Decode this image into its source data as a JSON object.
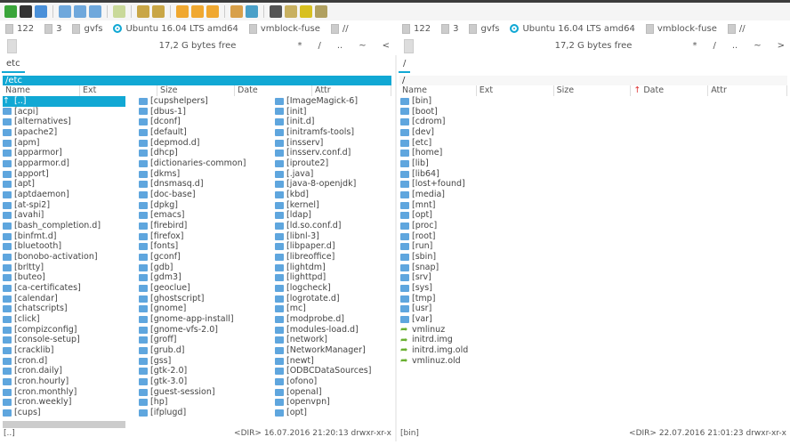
{
  "drives": [
    "122",
    "3",
    "gvfs",
    "Ubuntu 16.04 LTS amd64",
    "vmblock-fuse",
    "//"
  ],
  "left": {
    "free": "17,2 G bytes free",
    "navs": [
      "*",
      "/",
      "..",
      "~",
      "<"
    ],
    "tab": "etc",
    "path": "/etc",
    "columns": [
      "Name",
      "Ext",
      "Size",
      "Date",
      "Attr"
    ],
    "cols": [
      [
        "[..]",
        "[acpi]",
        "[alternatives]",
        "[apache2]",
        "[apm]",
        "[apparmor]",
        "[apparmor.d]",
        "[apport]",
        "[apt]",
        "[aptdaemon]",
        "[at-spi2]",
        "[avahi]",
        "[bash_completion.d]",
        "[binfmt.d]",
        "[bluetooth]",
        "[bonobo-activation]",
        "[brltty]",
        "[buteo]",
        "[ca-certificates]",
        "[calendar]",
        "[chatscripts]",
        "[click]",
        "[compizconfig]",
        "[console-setup]",
        "[cracklib]",
        "[cron.d]",
        "[cron.daily]",
        "[cron.hourly]",
        "[cron.monthly]",
        "[cron.weekly]",
        "[cups]"
      ],
      [
        "[cupshelpers]",
        "[dbus-1]",
        "[dconf]",
        "[default]",
        "[depmod.d]",
        "[dhcp]",
        "[dictionaries-common]",
        "[dkms]",
        "[dnsmasq.d]",
        "[doc-base]",
        "[dpkg]",
        "[emacs]",
        "[firebird]",
        "[firefox]",
        "[fonts]",
        "[gconf]",
        "[gdb]",
        "[gdm3]",
        "[geoclue]",
        "[ghostscript]",
        "[gnome]",
        "[gnome-app-install]",
        "[gnome-vfs-2.0]",
        "[groff]",
        "[grub.d]",
        "[gss]",
        "[gtk-2.0]",
        "[gtk-3.0]",
        "[guest-session]",
        "[hp]",
        "[ifplugd]"
      ],
      [
        "[ImageMagick-6]",
        "[init]",
        "[init.d]",
        "[initramfs-tools]",
        "[insserv]",
        "[insserv.conf.d]",
        "[iproute2]",
        "[.java]",
        "[java-8-openjdk]",
        "[kbd]",
        "[kernel]",
        "[ldap]",
        "[ld.so.conf.d]",
        "[libnl-3]",
        "[libpaper.d]",
        "[libreoffice]",
        "[lightdm]",
        "[lighttpd]",
        "[logcheck]",
        "[logrotate.d]",
        "[mc]",
        "[modprobe.d]",
        "[modules-load.d]",
        "[network]",
        "[NetworkManager]",
        "[newt]",
        "[ODBCDataSources]",
        "[ofono]",
        "[openal]",
        "[openvpn]",
        "[opt]"
      ]
    ],
    "status_name": "[..]",
    "status_info": "<DIR> 16.07.2016 21:20:13  drwxr-xr-x"
  },
  "right": {
    "free": "17,2 G bytes free",
    "navs": [
      "*",
      "/",
      "..",
      "~",
      ">"
    ],
    "tab": "/",
    "path": "/",
    "columns": [
      "Name",
      "Ext",
      "Size",
      "Date",
      "Attr"
    ],
    "sort_indicator": "↑",
    "dirs": [
      "[bin]",
      "[boot]",
      "[cdrom]",
      "[dev]",
      "[etc]",
      "[home]",
      "[lib]",
      "[lib64]",
      "[lost+found]",
      "[media]",
      "[mnt]",
      "[opt]",
      "[proc]",
      "[root]",
      "[run]",
      "[sbin]",
      "[snap]",
      "[srv]",
      "[sys]",
      "[tmp]",
      "[usr]",
      "[var]"
    ],
    "files": [
      "vmlinuz",
      "initrd.img",
      "initrd.img.old",
      "vmlinuz.old"
    ],
    "status_name": "[bin]",
    "status_info": "<DIR> 22.07.2016 21:01:23  drwxr-xr-x"
  },
  "colors": {
    "accent": "#11a8d4",
    "folder": "#5fa6de"
  }
}
